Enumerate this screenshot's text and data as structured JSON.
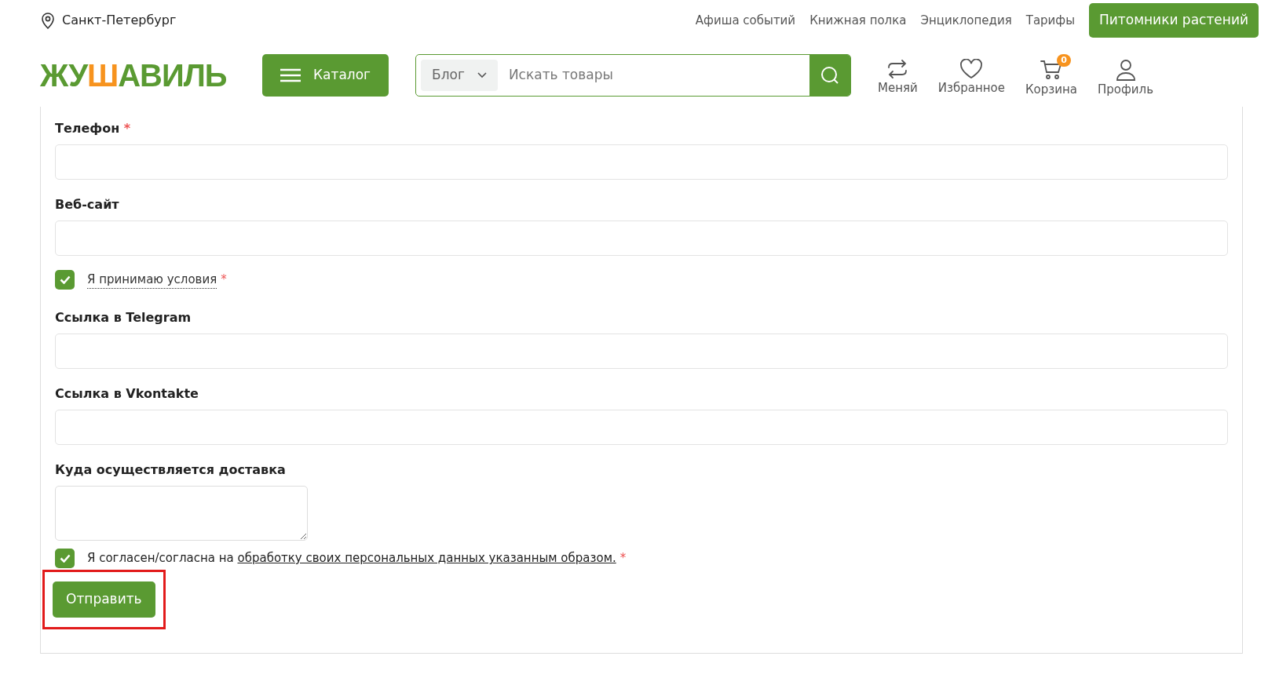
{
  "header": {
    "city": "Санкт-Петербург",
    "top_links": [
      "Афиша событий",
      "Книжная полка",
      "Энциклопедия",
      "Тарифы"
    ],
    "top_button": "Питомники растений",
    "logo": {
      "start": "ЖУ",
      "accent": "Ш",
      "end": "АВИЛЬ"
    },
    "catalog_button": "Каталог",
    "search": {
      "scope": "Блог",
      "placeholder": "Искать товары"
    },
    "actions": [
      {
        "kind": "swap",
        "label": "Меняй"
      },
      {
        "kind": "heart",
        "label": "Избранное"
      },
      {
        "kind": "cart",
        "label": "Корзина",
        "badge": "0"
      },
      {
        "kind": "user",
        "label": "Профиль"
      }
    ]
  },
  "form": {
    "fields": [
      {
        "kind": "input",
        "label": "Телефон",
        "required_mark": "*"
      },
      {
        "kind": "input",
        "label": "Веб-сайт"
      },
      {
        "kind": "checkbox",
        "link": "Я принимаю условия",
        "checked": true,
        "required_mark": "*"
      },
      {
        "kind": "input",
        "label": "Ссылка в Telegram"
      },
      {
        "kind": "input",
        "label": "Ссылка в Vkontakte"
      },
      {
        "kind": "textarea",
        "label": "Куда осуществляется доставка"
      },
      {
        "kind": "checkbox",
        "text": "Я согласен/согласна на",
        "link": "обработку своих персональных данных указанным образом.",
        "checked": true,
        "required_mark": "*"
      }
    ],
    "submit": {
      "label": "Отправить",
      "highlighted": true
    }
  }
}
